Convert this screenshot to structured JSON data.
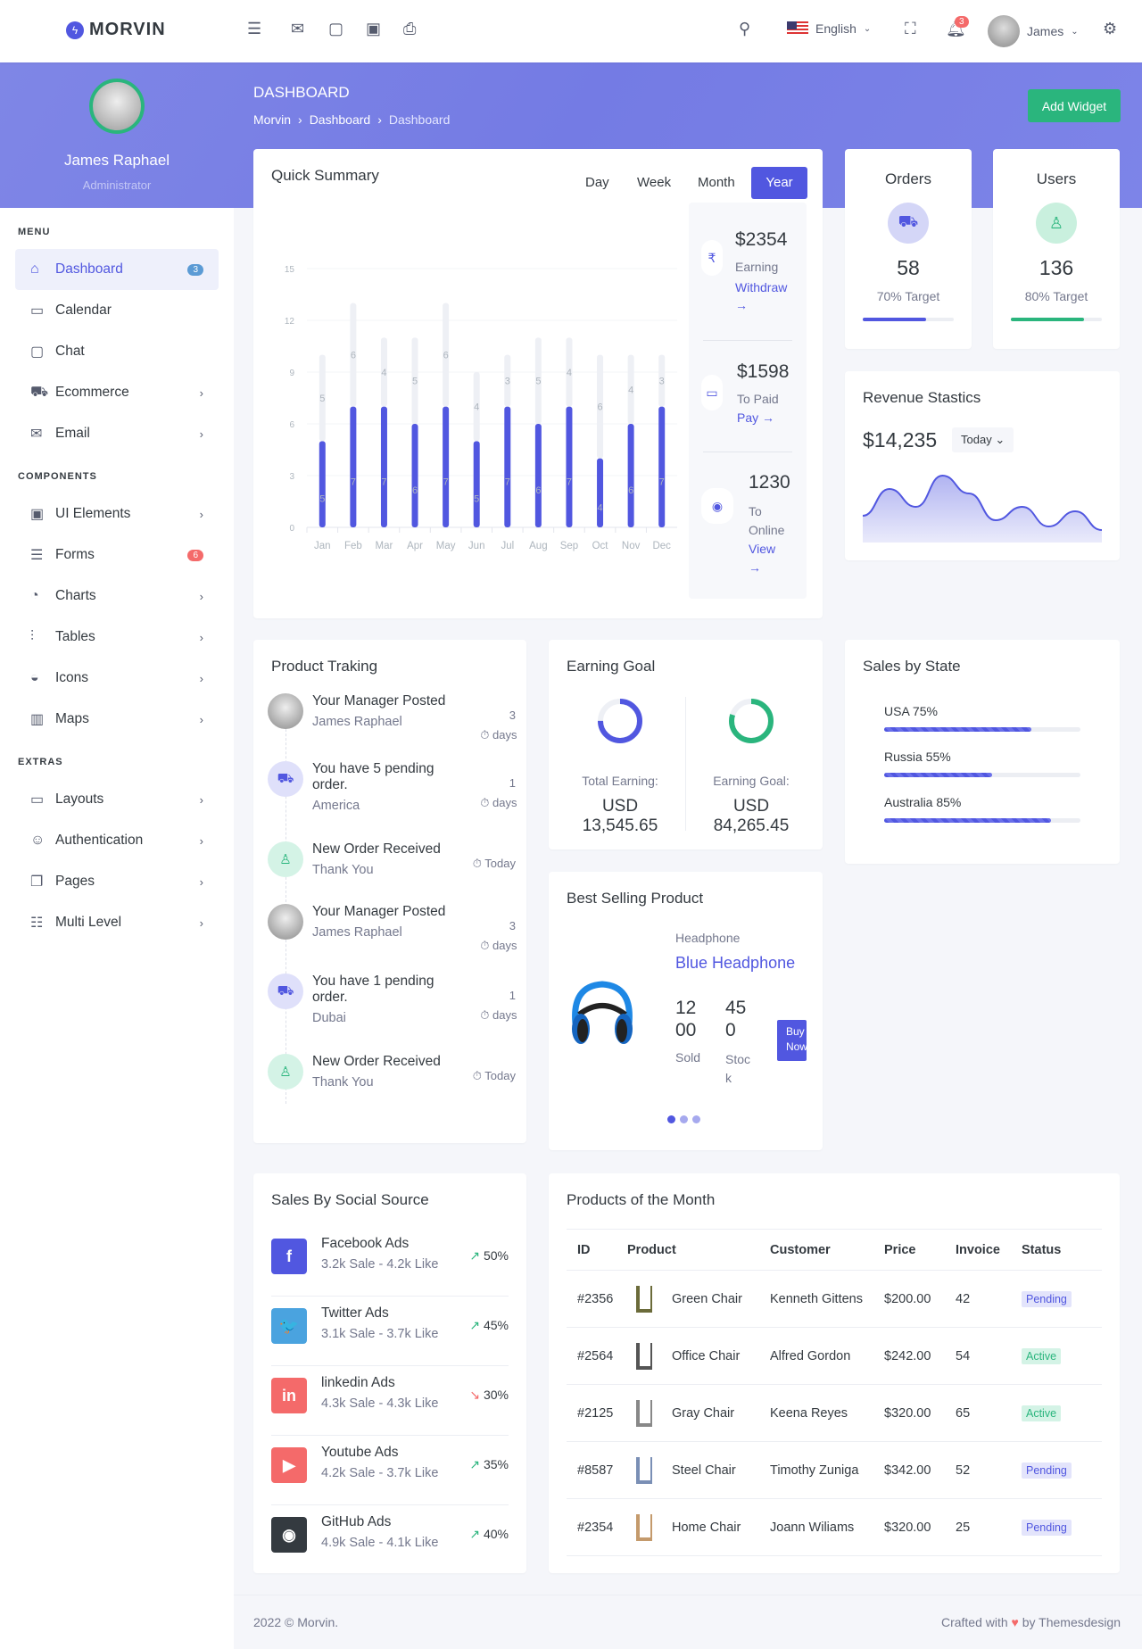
{
  "header": {
    "brand": "MORVIN",
    "language": "English",
    "notifications": "3",
    "user": "James",
    "icons": [
      "menu-icon",
      "mail-icon",
      "chat-icon",
      "calendar-icon",
      "printer-icon",
      "search-icon",
      "fullscreen-icon",
      "bell-icon",
      "gear-icon"
    ]
  },
  "profile": {
    "name": "James Raphael",
    "role": "Administrator"
  },
  "page": {
    "title": "DASHBOARD",
    "breadcrumb": [
      "Morvin",
      "Dashboard",
      "Dashboard"
    ],
    "add_widget": "Add Widget"
  },
  "sidebar": {
    "sections": [
      {
        "title": "MENU",
        "items": [
          {
            "label": "Dashboard",
            "icon": "⌂",
            "badge": "3",
            "badge_color": "#5b9bd5",
            "active": true
          },
          {
            "label": "Calendar",
            "icon": "▭"
          },
          {
            "label": "Chat",
            "icon": "▢"
          },
          {
            "label": "Ecommerce",
            "icon": "⛟",
            "arrow": true
          },
          {
            "label": "Email",
            "icon": "✉",
            "arrow": true
          }
        ]
      },
      {
        "title": "COMPONENTS",
        "items": [
          {
            "label": "UI Elements",
            "icon": "▣",
            "arrow": true
          },
          {
            "label": "Forms",
            "icon": "☰",
            "badge": "6",
            "badge_color": "#f46a6a"
          },
          {
            "label": "Charts",
            "icon": "◔",
            "arrow": true
          },
          {
            "label": "Tables",
            "icon": "⫶",
            "arrow": true
          },
          {
            "label": "Icons",
            "icon": "◒",
            "arrow": true
          },
          {
            "label": "Maps",
            "icon": "▥",
            "arrow": true
          }
        ]
      },
      {
        "title": "EXTRAS",
        "items": [
          {
            "label": "Layouts",
            "icon": "▭",
            "arrow": true
          },
          {
            "label": "Authentication",
            "icon": "☺",
            "arrow": true
          },
          {
            "label": "Pages",
            "icon": "❐",
            "arrow": true
          },
          {
            "label": "Multi Level",
            "icon": "☷",
            "arrow": true
          }
        ]
      }
    ]
  },
  "quick_summary": {
    "title": "Quick Summary",
    "tabs": [
      "Day",
      "Week",
      "Month",
      "Year"
    ],
    "active_tab": "Year",
    "items": [
      {
        "value": "$2354",
        "label": "Earning",
        "link": "Withdraw",
        "icon": "₹"
      },
      {
        "value": "$1598",
        "label": "To Paid",
        "link": "Pay",
        "icon": "▭"
      },
      {
        "value": "1230",
        "label": "To Online",
        "link": "View",
        "icon": "◉"
      }
    ]
  },
  "chart_data": {
    "type": "bar",
    "stacked": true,
    "categories": [
      "Jan",
      "Feb",
      "Mar",
      "Apr",
      "May",
      "Jun",
      "Jul",
      "Aug",
      "Sep",
      "Oct",
      "Nov",
      "Dec"
    ],
    "series": [
      {
        "values": [
          5,
          7,
          7,
          6,
          7,
          5,
          7,
          6,
          7,
          4,
          6,
          7
        ],
        "color": "#5157e0"
      },
      {
        "values": [
          5,
          6,
          4,
          5,
          6,
          4,
          3,
          5,
          4,
          6,
          4,
          3
        ],
        "color": "#eef0f5"
      }
    ],
    "ylim": [
      0,
      15
    ],
    "yticks": [
      0,
      3,
      6,
      9,
      12,
      15
    ],
    "grid": true
  },
  "orders": {
    "title": "Orders",
    "value": "58",
    "target": "70% Target",
    "progress": 70,
    "color": "#5157e0",
    "icon": "🛒"
  },
  "users": {
    "title": "Users",
    "value": "136",
    "target": "80% Target",
    "progress": 80,
    "color": "#2ab57d",
    "icon": "👤"
  },
  "revenue": {
    "title": "Revenue Stastics",
    "value": "$14,235",
    "period": "Today",
    "sparkline": [
      3,
      6,
      4,
      7.5,
      5.5,
      2.5,
      4,
      1.8,
      3.5,
      1.4
    ]
  },
  "tracking": {
    "title": "Product Traking",
    "items": [
      {
        "title": "Your Manager Posted",
        "sub": "James Raphael",
        "time": "3 days",
        "type": "avatar"
      },
      {
        "title": "You have 5 pending order.",
        "sub": "America",
        "time": "1 days",
        "type": "cart"
      },
      {
        "title": "New Order Received",
        "sub": "Thank You",
        "time": "Today",
        "type": "user"
      },
      {
        "title": "Your Manager Posted",
        "sub": "James Raphael",
        "time": "3 days",
        "type": "avatar"
      },
      {
        "title": "You have 1 pending order.",
        "sub": "Dubai",
        "time": "1 days",
        "type": "cart"
      },
      {
        "title": "New Order Received",
        "sub": "Thank You",
        "time": "Today",
        "type": "user"
      }
    ]
  },
  "earning_goal": {
    "title": "Earning Goal",
    "items": [
      {
        "label": "Total Earning:",
        "currency": "USD",
        "value": "13,545.65",
        "color": "#5157e0",
        "progress": 75
      },
      {
        "label": "Earning Goal:",
        "currency": "USD",
        "value": "84,265.45",
        "color": "#2ab57d",
        "progress": 80
      }
    ]
  },
  "best_selling": {
    "title": "Best Selling Product",
    "category": "Headphone",
    "name": "Blue Headphone",
    "sold": "1200",
    "sold_label": "Sold",
    "stock": "450",
    "stock_label": "Stock",
    "buy": "Buy Now"
  },
  "sales_state": {
    "title": "Sales by State",
    "items": [
      {
        "label": "USA 75%",
        "value": 75
      },
      {
        "label": "Russia 55%",
        "value": 55
      },
      {
        "label": "Australia 85%",
        "value": 85
      }
    ]
  },
  "social": {
    "title": "Sales By Social Source",
    "items": [
      {
        "name": "Facebook Ads",
        "stats": "3.2k Sale - 4.2k Like",
        "change": "50%",
        "trend": "up",
        "color": "#5157e0",
        "glyph": "f"
      },
      {
        "name": "Twitter Ads",
        "stats": "3.1k Sale - 3.7k Like",
        "change": "45%",
        "trend": "up",
        "color": "#4aa3df",
        "glyph": "🐦"
      },
      {
        "name": "linkedin Ads",
        "stats": "4.3k Sale - 4.3k Like",
        "change": "30%",
        "trend": "down",
        "color": "#f46a6a",
        "glyph": "in"
      },
      {
        "name": "Youtube Ads",
        "stats": "4.2k Sale - 3.7k Like",
        "change": "35%",
        "trend": "up",
        "color": "#f46a6a",
        "glyph": "▶"
      },
      {
        "name": "GitHub Ads",
        "stats": "4.9k Sale - 4.1k Like",
        "change": "40%",
        "trend": "up",
        "color": "#343a40",
        "glyph": "◉"
      }
    ]
  },
  "products": {
    "title": "Products of the Month",
    "columns": [
      "ID",
      "Product",
      "Customer",
      "Price",
      "Invoice",
      "Status"
    ],
    "rows": [
      {
        "id": "#2356",
        "product": "Green Chair",
        "customer": "Kenneth Gittens",
        "price": "$200.00",
        "invoice": "42",
        "status": "Pending"
      },
      {
        "id": "#2564",
        "product": "Office Chair",
        "customer": "Alfred Gordon",
        "price": "$242.00",
        "invoice": "54",
        "status": "Active"
      },
      {
        "id": "#2125",
        "product": "Gray Chair",
        "customer": "Keena Reyes",
        "price": "$320.00",
        "invoice": "65",
        "status": "Active"
      },
      {
        "id": "#8587",
        "product": "Steel Chair",
        "customer": "Timothy Zuniga",
        "price": "$342.00",
        "invoice": "52",
        "status": "Pending"
      },
      {
        "id": "#2354",
        "product": "Home Chair",
        "customer": "Joann Wiliams",
        "price": "$320.00",
        "invoice": "25",
        "status": "Pending"
      }
    ]
  },
  "footer": {
    "copyright": "2022 © Morvin.",
    "crafted_prefix": "Crafted with",
    "crafted_suffix": "by Themesdesign"
  }
}
